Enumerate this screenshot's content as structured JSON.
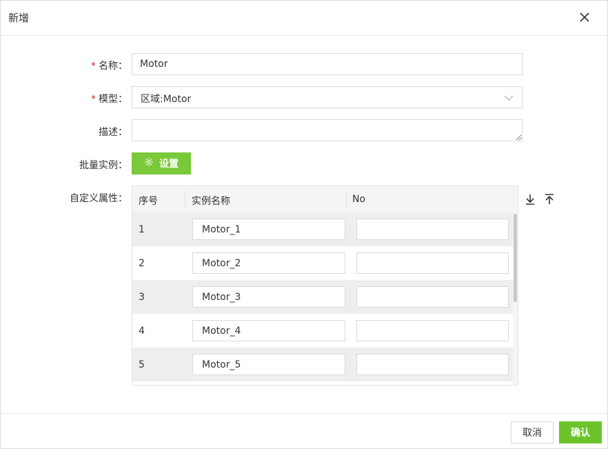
{
  "dialog": {
    "title": "新增",
    "close_icon": "close-icon"
  },
  "form": {
    "name": {
      "required": "*",
      "label": "名称：",
      "value": "Motor"
    },
    "model": {
      "required": "*",
      "label": "模型：",
      "value": "区域:Motor",
      "icon": "chevron-down-icon"
    },
    "description": {
      "label": "描述：",
      "value": ""
    },
    "batch": {
      "label": "批量实例：",
      "button_label": "设置",
      "icon": "gear-icon"
    },
    "custom_attrs": {
      "label": "自定义属性："
    }
  },
  "table": {
    "columns": [
      "序号",
      "实例名称",
      "No"
    ],
    "rows": [
      {
        "index": "1",
        "instance_name": "Motor_1",
        "no": ""
      },
      {
        "index": "2",
        "instance_name": "Motor_2",
        "no": ""
      },
      {
        "index": "3",
        "instance_name": "Motor_3",
        "no": ""
      },
      {
        "index": "4",
        "instance_name": "Motor_4",
        "no": ""
      },
      {
        "index": "5",
        "instance_name": "Motor_5",
        "no": ""
      }
    ],
    "tools": [
      "download-arrow-icon",
      "upload-arrow-icon"
    ]
  },
  "footer": {
    "cancel_label": "取消",
    "confirm_label": "确认"
  },
  "colors": {
    "accent": "#7ac93a",
    "required": "#e02020",
    "row_stripe": "#eeeeee"
  }
}
